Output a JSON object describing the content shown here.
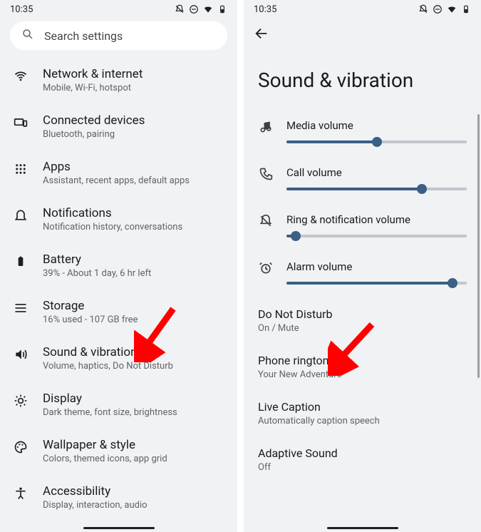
{
  "status": {
    "time": "10:35"
  },
  "left": {
    "search_label": "Search settings",
    "items": [
      {
        "title": "Network & internet",
        "sub": "Mobile, Wi-Fi, hotspot"
      },
      {
        "title": "Connected devices",
        "sub": "Bluetooth, pairing"
      },
      {
        "title": "Apps",
        "sub": "Assistant, recent apps, default apps"
      },
      {
        "title": "Notifications",
        "sub": "Notification history, conversations"
      },
      {
        "title": "Battery",
        "sub": "39% - About 1 day, 6 hr left"
      },
      {
        "title": "Storage",
        "sub": "16% used - 107 GB free"
      },
      {
        "title": "Sound & vibration",
        "sub": "Volume, haptics, Do Not Disturb"
      },
      {
        "title": "Display",
        "sub": "Dark theme, font size, brightness"
      },
      {
        "title": "Wallpaper & style",
        "sub": "Colors, themed icons, app grid"
      },
      {
        "title": "Accessibility",
        "sub": "Display, interaction, audio"
      }
    ]
  },
  "right": {
    "page_title": "Sound & vibration",
    "sliders": [
      {
        "label": "Media volume",
        "pct": 50
      },
      {
        "label": "Call volume",
        "pct": 75
      },
      {
        "label": "Ring & notification volume",
        "pct": 5
      },
      {
        "label": "Alarm volume",
        "pct": 92
      }
    ],
    "rows": [
      {
        "title": "Do Not Disturb",
        "sub": "On / Mute"
      },
      {
        "title": "Phone ringtone",
        "sub": "Your New Adventure"
      },
      {
        "title": "Live Caption",
        "sub": "Automatically caption speech"
      },
      {
        "title": "Adaptive Sound",
        "sub": "Off"
      }
    ]
  }
}
